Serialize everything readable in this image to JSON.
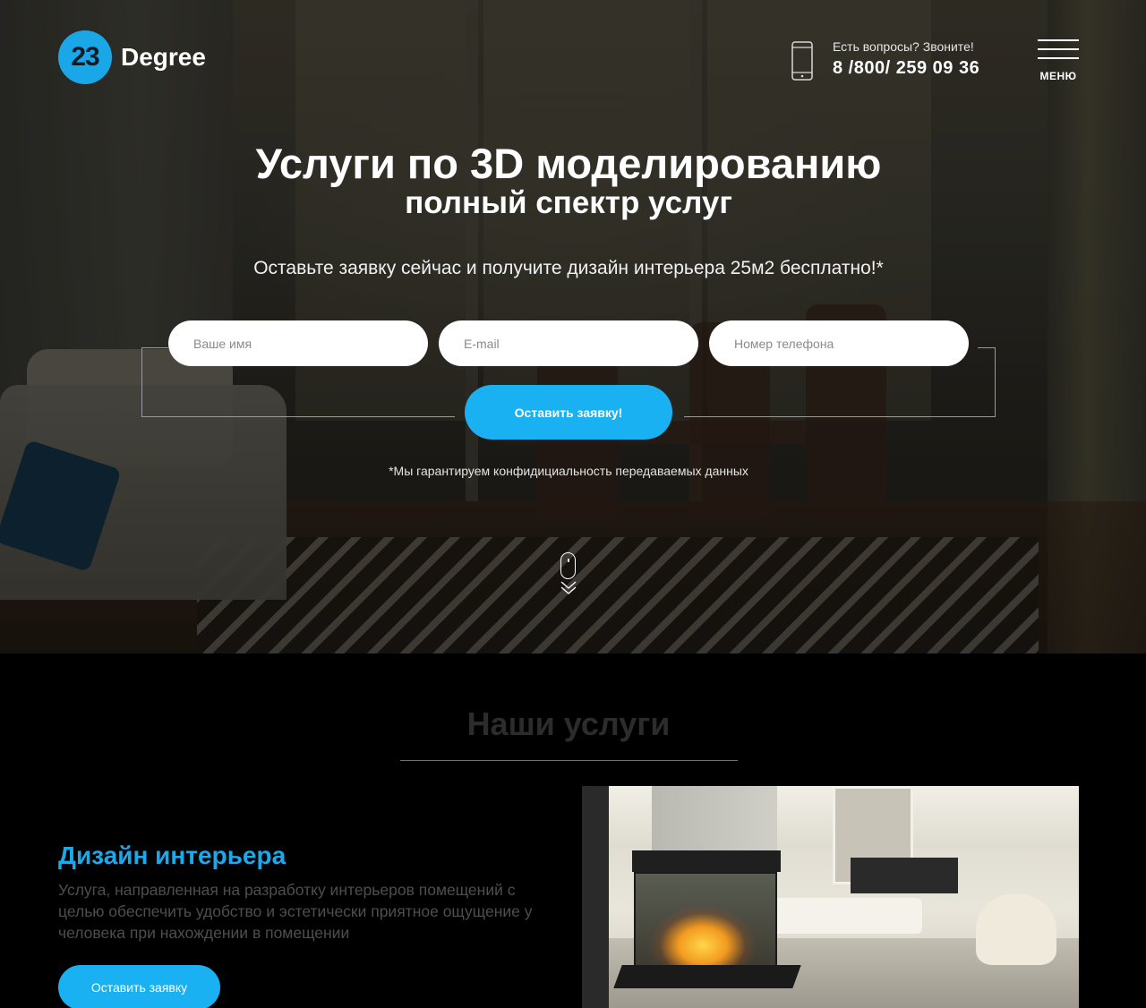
{
  "header": {
    "logo_number": "23",
    "logo_word": "Degree",
    "contact_question": "Есть вопросы? Звоните!",
    "contact_phone": "8 /800/ 259 09 36",
    "menu_label": "МЕНЮ"
  },
  "hero": {
    "title": "Услуги по 3D моделированию",
    "subtitle": "полный спектр услуг",
    "offer": "Оставьте заявку сейчас и получите дизайн интерьера 25м2 бесплатно!*",
    "form": {
      "name_placeholder": "Ваше имя",
      "email_placeholder": "E-mail",
      "phone_placeholder": "Номер телефона",
      "submit_label": "Оставить заявку!"
    },
    "privacy_note": "*Мы гарантируем конфидициальность передаваемых данных"
  },
  "services": {
    "title": "Наши услуги",
    "items": [
      {
        "heading": "Дизайн интерьера",
        "description": "Услуга, направленная на разработку интерьеров помещений с целью обеспечить удобство и эстетически приятное ощущение у человека при нахождении в помещении",
        "button_label": "Оставить заявку"
      }
    ]
  },
  "colors": {
    "accent": "#1ab1f3",
    "logo_circle": "#1aa7e8",
    "service_heading": "#1aa9ea",
    "divider": "#3f7fb9"
  },
  "icons": [
    "phone-icon",
    "menu-icon",
    "scroll-mouse-icon",
    "double-chevron-down-icon"
  ]
}
